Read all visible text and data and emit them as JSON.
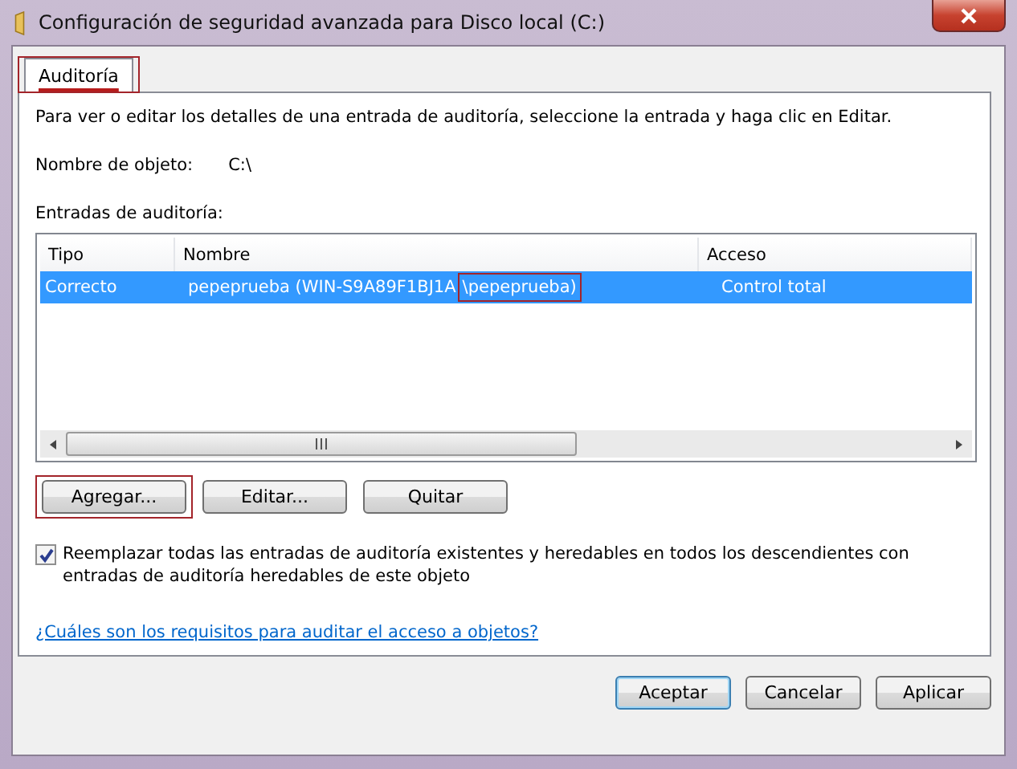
{
  "window": {
    "title": "Configuración de seguridad avanzada para Disco local (C:)"
  },
  "tabs": [
    {
      "label": "Auditoría",
      "selected": true,
      "highlighted": true
    }
  ],
  "description": "Para ver o editar los detalles de una entrada de auditoría, seleccione la entrada y haga clic en Editar.",
  "object_name": {
    "label": "Nombre de objeto:",
    "value": "C:\\"
  },
  "entries": {
    "label": "Entradas de auditoría:",
    "columns": [
      "Tipo",
      "Nombre",
      "Acceso"
    ],
    "rows": [
      {
        "selected": true,
        "type": "Correcto",
        "name_parts": [
          {
            "text": "pepeprueba (WIN-S9A89F1BJ1A",
            "highlighted": false
          },
          {
            "text": "\\pepeprueba)",
            "highlighted": true
          }
        ],
        "access": "Control total"
      }
    ]
  },
  "actions": [
    {
      "label": "Agregar...",
      "highlighted": true
    },
    {
      "label": "Editar...",
      "highlighted": false
    },
    {
      "label": "Quitar",
      "highlighted": false
    }
  ],
  "replace_option": {
    "label": "Reemplazar todas las entradas de auditoría existentes y heredables en todos los descendientes con entradas de auditoría heredables de este objeto",
    "checked": true
  },
  "help_link": "¿Cuáles son los requisitos para auditar el acceso a objetos?",
  "buttons": [
    {
      "label": "Aceptar",
      "default": true
    },
    {
      "label": "Cancelar",
      "default": false
    },
    {
      "label": "Aplicar",
      "default": false
    }
  ]
}
